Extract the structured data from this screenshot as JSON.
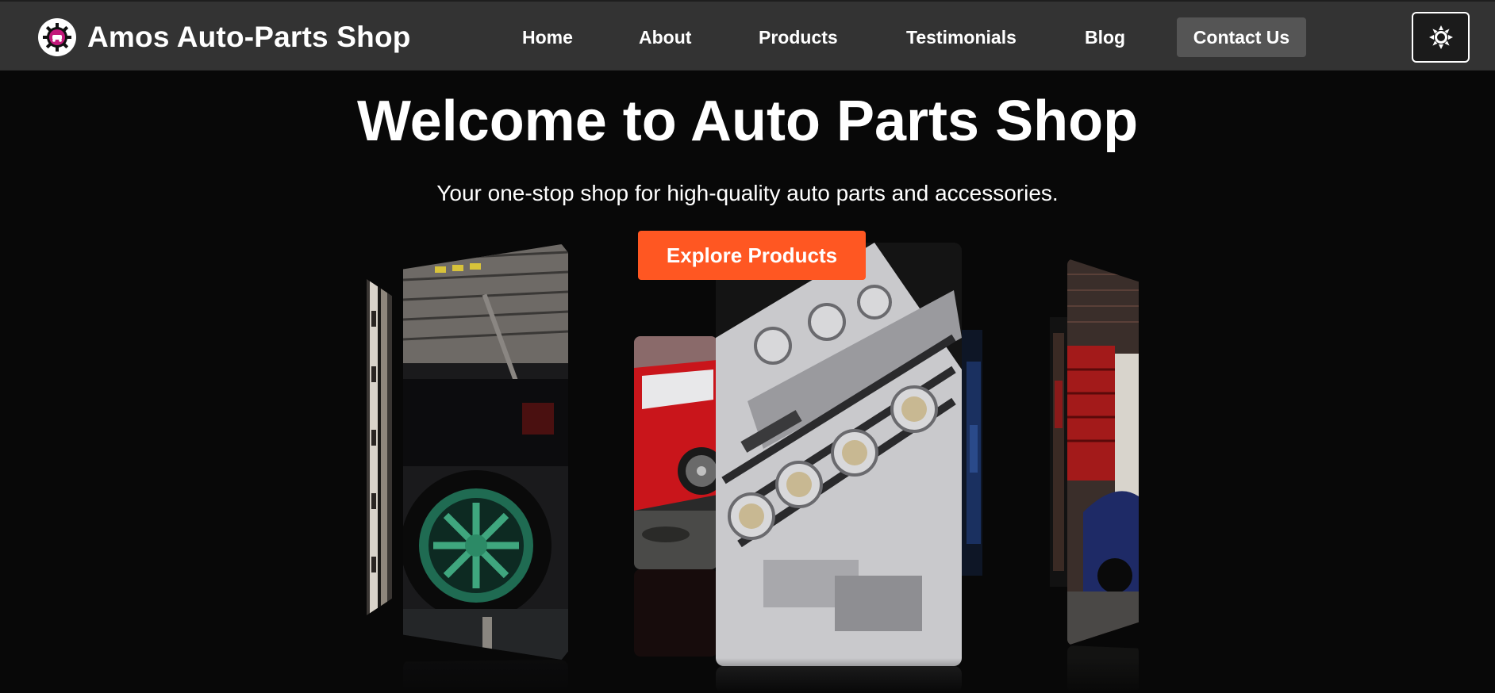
{
  "brand": {
    "name": "Amos Auto-Parts Shop",
    "logo_icon": "gear-logo-icon"
  },
  "nav": {
    "items": [
      {
        "label": "Home"
      },
      {
        "label": "About"
      },
      {
        "label": "Products"
      },
      {
        "label": "Testimonials"
      },
      {
        "label": "Blog"
      }
    ],
    "contact_label": "Contact Us",
    "theme_toggle_icon": "sun-icon"
  },
  "hero": {
    "title": "Welcome to Auto Parts Shop",
    "subtitle": "Your one-stop shop for high-quality auto parts and accessories.",
    "cta_label": "Explore Products"
  },
  "carousel": {
    "images": [
      {
        "subject": "car wheel rim close-up"
      },
      {
        "subject": "car on lift in garage with green wheel"
      },
      {
        "subject": "red car with brake disc"
      },
      {
        "subject": "engine intake manifold on cloth"
      },
      {
        "subject": "blue car panel"
      },
      {
        "subject": "workshop tool cabinet"
      },
      {
        "subject": "garage interior with blue car"
      }
    ]
  },
  "colors": {
    "navbar_bg": "#333333",
    "page_bg": "#080808",
    "accent": "#ff5722",
    "contact_bg": "#555555",
    "logo_accent": "#c2187a"
  }
}
